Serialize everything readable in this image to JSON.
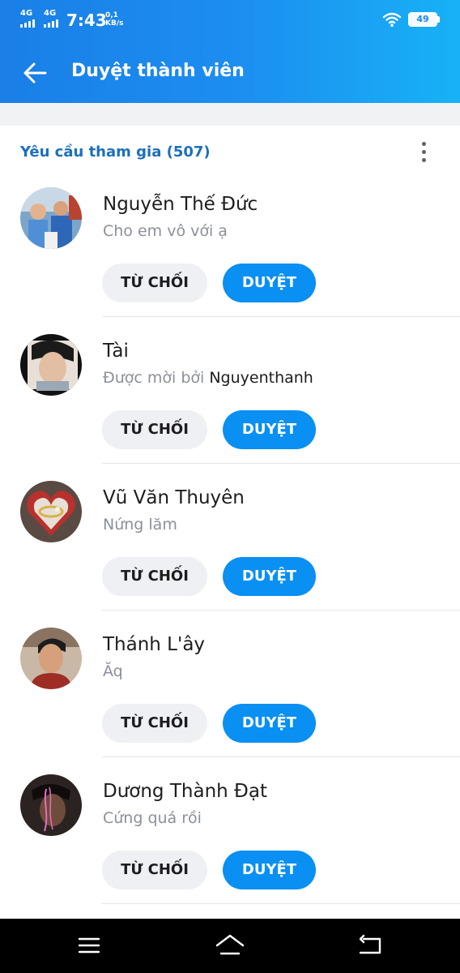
{
  "status_bar": {
    "signal_1_label": "4G",
    "signal_2_label": "4G",
    "time": "7:43",
    "speed_value": "0,1",
    "speed_unit": "KB/s",
    "battery_level": "49"
  },
  "app_bar": {
    "back_icon": "arrow-left-icon",
    "title": "Duyệt thành viên"
  },
  "section": {
    "title": "Yêu cầu tham gia (507)",
    "more_icon": "more-vertical-icon"
  },
  "requests": [
    {
      "name": "Nguyễn Thế Đức",
      "message": "Cho em vô với ạ",
      "reject_label": "TỪ CHỐI",
      "approve_label": "DUYỆT"
    },
    {
      "name": "Tài",
      "message_prefix": "Được mời bởi",
      "inviter": "Nguyenthanh",
      "reject_label": "TỪ CHỐI",
      "approve_label": "DUYỆT"
    },
    {
      "name": "Vũ Văn Thuyên",
      "message": "Nứng lăm",
      "reject_label": "TỪ CHỐI",
      "approve_label": "DUYỆT"
    },
    {
      "name": "Thánh L'ây",
      "message": "Ăq",
      "reject_label": "TỪ CHỐI",
      "approve_label": "DUYỆT"
    },
    {
      "name": "Dương Thành Đạt",
      "message": "Cứng quá rồi",
      "reject_label": "TỪ CHỐI",
      "approve_label": "DUYỆT"
    }
  ],
  "nav_bar": {
    "menu_icon": "menu-icon",
    "home_icon": "home-icon",
    "back_icon": "back-icon"
  },
  "colors": {
    "header_gradient_start": "#1a7fe6",
    "header_gradient_end": "#18b1f6",
    "accent": "#0a8ff2",
    "section_title": "#1b6fbd",
    "reject_button_bg": "#eef0f3"
  }
}
